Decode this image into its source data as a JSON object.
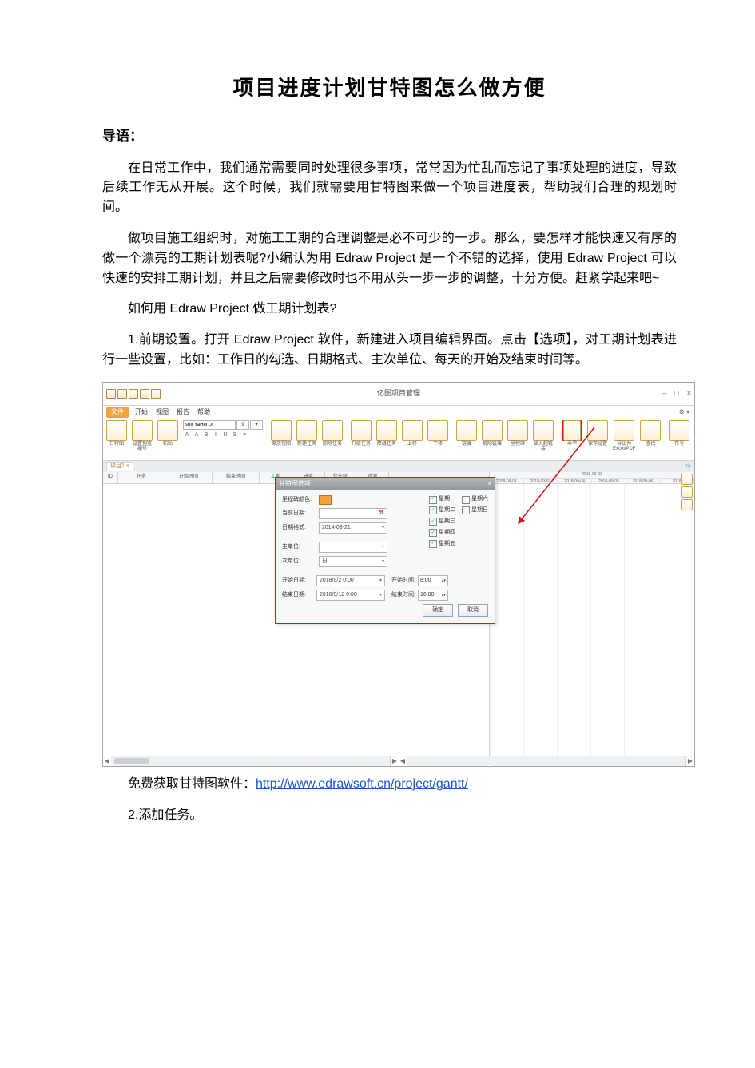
{
  "title": "项目进度计划甘特图怎么做方便",
  "lead_label": "导语：",
  "paragraphs": {
    "p1": "在日常工作中，我们通常需要同时处理很多事项，常常因为忙乱而忘记了事项处理的进度，导致后续工作无从开展。这个时候，我们就需要用甘特图来做一个项目进度表，帮助我们合理的规划时间。",
    "p2": "做项目施工组织时，对施工工期的合理调整是必不可少的一步。那么，要怎样才能快速又有序的做一个漂亮的工期计划表呢?小编认为用 Edraw Project 是一个不错的选择，使用 Edraw Project 可以快速的安排工期计划，并且之后需要修改时也不用从头一步一步的调整，十分方便。赶紧学起来吧~",
    "p3": "如何用 Edraw Project 做工期计划表?",
    "p4": "1.前期设置。打开 Edraw Project 软件，新建进入项目编辑界面。点击【选项】，对工期计划表进行一些设置，比如：工作日的勾选、日期格式、主次单位、每天的开始及结束时间等。",
    "footer_label": "免费获取甘特图软件：",
    "footer_link": "http://www.edrawsoft.cn/project/gantt/",
    "p5": "2.添加任务。"
  },
  "app": {
    "window_title": "亿图项目管理",
    "window_buttons": {
      "min": "–",
      "max": "□",
      "close": "×"
    },
    "quick_access": [
      "保存",
      "撤销",
      "重做",
      "打印",
      "打开"
    ],
    "menu": {
      "file": "文件",
      "items": [
        "开始",
        "视图",
        "报告",
        "帮助"
      ],
      "gear": "⚙ ▾"
    },
    "ribbon": {
      "font_name": "soft YaHei UI",
      "font_size": "9",
      "groups_left": [
        {
          "label": "甘特图"
        },
        {
          "label": "设置列宽\n编号"
        }
      ],
      "clipboard": "粘贴",
      "format_line1": [
        "B",
        "I",
        "U",
        "S",
        "≡"
      ],
      "format_line2": [
        "A",
        "A"
      ],
      "groups_mid": [
        "缩放视图",
        "新建任务",
        "删除任务",
        "升级任务",
        "降级任务",
        "上移",
        "下移"
      ],
      "groups_mid2": [
        "链接",
        "解除链接",
        "里程碑",
        "插入超链接"
      ],
      "options_btn": "选项",
      "groups_right2": [
        "保存设置",
        "导出为Excel/PDF"
      ],
      "right_icons": [
        "查找",
        "符号"
      ]
    },
    "tab": {
      "name": "项目1",
      "close": "×"
    },
    "columns": {
      "id": "ID",
      "name": "任务",
      "start": "开始时间",
      "end": "结束时间",
      "dur": "工期",
      "prog": "进度",
      "pri": "优先级",
      "res": "资源"
    },
    "dates": {
      "top": "2018-09-03",
      "cells": [
        "2018-09-02",
        "2018-09-03",
        "2018-09-04",
        "2018-09-05",
        "2018-09-06",
        "2018"
      ]
    },
    "side_icons": [
      "展开",
      "折叠",
      "导出"
    ],
    "hscroll": {
      "left": "◀",
      "right": "▶"
    }
  },
  "dialog": {
    "title": "甘特图选项",
    "close": "×",
    "rows": {
      "highlight_lbl": "里程碑颜色:",
      "today_lbl": "当前日期:",
      "today_icon": "📅",
      "datefmt_lbl": "日期格式:",
      "datefmt_val": "2014-03-21",
      "main_lbl": "主单位:",
      "main_val": "",
      "sub_lbl": "次单位:",
      "sub_val": "日"
    },
    "weekdays": [
      {
        "label": "星期一",
        "checked": true
      },
      {
        "label": "星期六",
        "checked": false
      },
      {
        "label": "星期二",
        "checked": true
      },
      {
        "label": "星期日",
        "checked": false
      },
      {
        "label": "星期三",
        "checked": true
      },
      {
        "label": "星期四",
        "checked": true
      },
      {
        "label": "星期五",
        "checked": true
      }
    ],
    "range": {
      "start_lbl": "开始日期:",
      "start_val": "2018/9/2 0:00",
      "end_lbl": "结束日期:",
      "end_val": "2018/9/12 0:00",
      "begin_lbl": "开始时间:",
      "begin_val": "8:00",
      "finish_lbl": "结束时间:",
      "finish_val": "16:00"
    },
    "buttons": {
      "ok": "确定",
      "cancel": "取消"
    }
  }
}
